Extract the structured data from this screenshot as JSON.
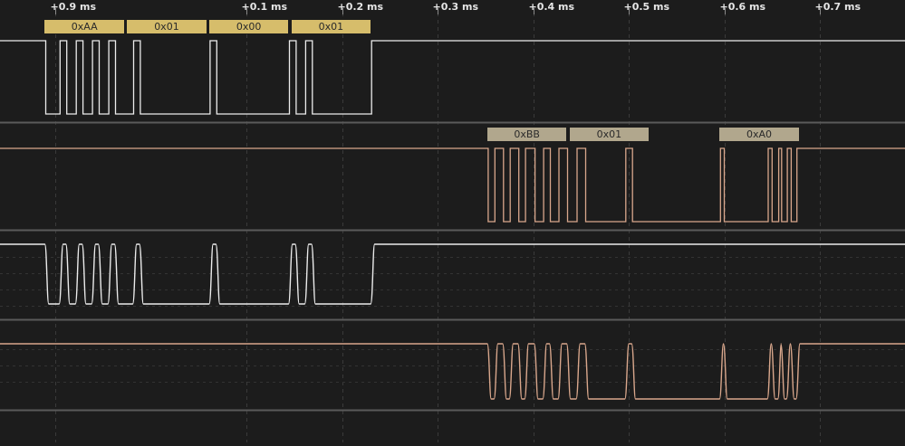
{
  "timeline": {
    "ticks": [
      {
        "label": "+0.9 ms",
        "t": -0.1
      },
      {
        "label": "+0.1 ms",
        "t": 0.1
      },
      {
        "label": "+0.2 ms",
        "t": 0.2
      },
      {
        "label": "+0.3 ms",
        "t": 0.3
      },
      {
        "label": "+0.4 ms",
        "t": 0.4
      },
      {
        "label": "+0.5 ms",
        "t": 0.5
      },
      {
        "label": "+0.6 ms",
        "t": 0.6
      },
      {
        "label": "+0.7 ms",
        "t": 0.7
      }
    ]
  },
  "colors": {
    "background": "#1c1c1c",
    "grid": "#3a3a3a",
    "separator": "#5a5a5a",
    "channel0": "#ececec",
    "channel1": "#d9a78c",
    "decode0": "#d6bd6b",
    "decode1": "#b1a78d"
  },
  "channels": [
    {
      "id": "digital-0",
      "color": "channel0",
      "decodes": [
        {
          "label": "0xAA",
          "t0": -0.11,
          "t1": -0.027
        },
        {
          "label": "0x01",
          "t0": -0.024,
          "t1": 0.059
        },
        {
          "label": "0x00",
          "t0": 0.062,
          "t1": 0.145
        },
        {
          "label": "0x01",
          "t0": 0.148,
          "t1": 0.231
        }
      ],
      "edges": [
        -0.11,
        -0.095,
        -0.088,
        -0.078,
        -0.071,
        -0.061,
        -0.054,
        -0.044,
        -0.037,
        -0.018,
        -0.011,
        0.062,
        0.069,
        0.145,
        0.152,
        0.162,
        0.169,
        0.231
      ],
      "initial": "high",
      "final": "high"
    },
    {
      "id": "digital-1",
      "color": "channel1",
      "decodes": [
        {
          "label": "0xBB",
          "t0": 0.353,
          "t1": 0.436
        },
        {
          "label": "0x01",
          "t0": 0.439,
          "t1": 0.522
        },
        {
          "label": "0xA0",
          "t0": 0.596,
          "t1": 0.679
        }
      ],
      "edges": [
        0.353,
        0.36,
        0.369,
        0.376,
        0.385,
        0.392,
        0.402,
        0.411,
        0.418,
        0.427,
        0.436,
        0.446,
        0.455,
        0.497,
        0.504,
        0.596,
        0.6,
        0.646,
        0.65,
        0.657,
        0.66,
        0.666,
        0.67,
        0.676
      ],
      "initial": "high",
      "final": "high"
    }
  ]
}
